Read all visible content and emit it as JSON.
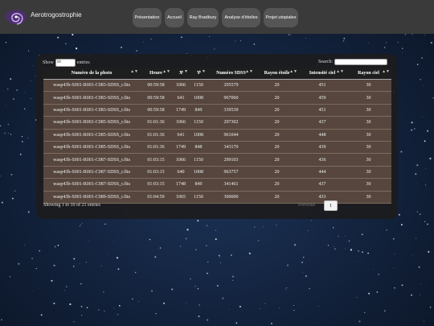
{
  "brand": "Aerotrogostrophie",
  "nav": [
    "Présentation",
    "Accueil",
    "Ray Bradbury",
    "Analyse d'étoiles",
    "Projet utopiales"
  ],
  "table_controls": {
    "show_label": "Show",
    "show_value": "10",
    "entries_label": "entries",
    "search_label": "Search:",
    "search_value": ""
  },
  "table": {
    "headers": [
      "Numéro de la photo",
      "Heure",
      "X",
      "Y",
      "Numéro SDSS",
      "Rayon étoile",
      "Intensité ciel",
      "Rayon ciel"
    ],
    "rows": [
      [
        "wasp43b-S001-R001-C083-SDSS_r.fits",
        "00:59:58",
        "1066",
        "1150",
        "295579",
        "20",
        "451",
        "30"
      ],
      [
        "wasp43b-S001-R001-C083-SDSS_r.fits",
        "00:59:58",
        "641",
        "1008",
        "967060",
        "20",
        "459",
        "30"
      ],
      [
        "wasp43b-S001-R001-C083-SDSS_r.fits",
        "00:59:58",
        "1749",
        "849",
        "339539",
        "20",
        "451",
        "30"
      ],
      [
        "wasp43b-S001-R001-C085-SDSS_r.fits",
        "01:01:36",
        "1066",
        "1150",
        "297302",
        "20",
        "437",
        "30"
      ],
      [
        "wasp43b-S001-R001-C085-SDSS_r.fits",
        "01:01:36",
        "641",
        "1008",
        "961044",
        "20",
        "448",
        "30"
      ],
      [
        "wasp43b-S001-R001-C085-SDSS_r.fits",
        "01:01:36",
        "1749",
        "848",
        "343170",
        "20",
        "439",
        "30"
      ],
      [
        "wasp43b-S001-R001-C087-SDSS_r.fits",
        "01:03:15",
        "1066",
        "1150",
        "299103",
        "20",
        "436",
        "30"
      ],
      [
        "wasp43b-S001-R001-C087-SDSS_r.fits",
        "01:03:15",
        "640",
        "1008",
        "963757",
        "20",
        "444",
        "30"
      ],
      [
        "wasp43b-S001-R001-C087-SDSS_r.fits",
        "01:03:15",
        "1748",
        "849",
        "341461",
        "20",
        "437",
        "30"
      ],
      [
        "wasp43b-S001-R001-C089-SDSS_r.fits",
        "01:04:59",
        "1065",
        "1150",
        "300000",
        "20",
        "433",
        "30"
      ]
    ]
  },
  "footer": {
    "info": "Showing 1 to 10 of 21 entries",
    "previous": "Previous",
    "page": "1"
  },
  "colors": {
    "navbar": "#3a3a3a",
    "row_bg": "#56463d",
    "panel": "#1c1c1e"
  }
}
